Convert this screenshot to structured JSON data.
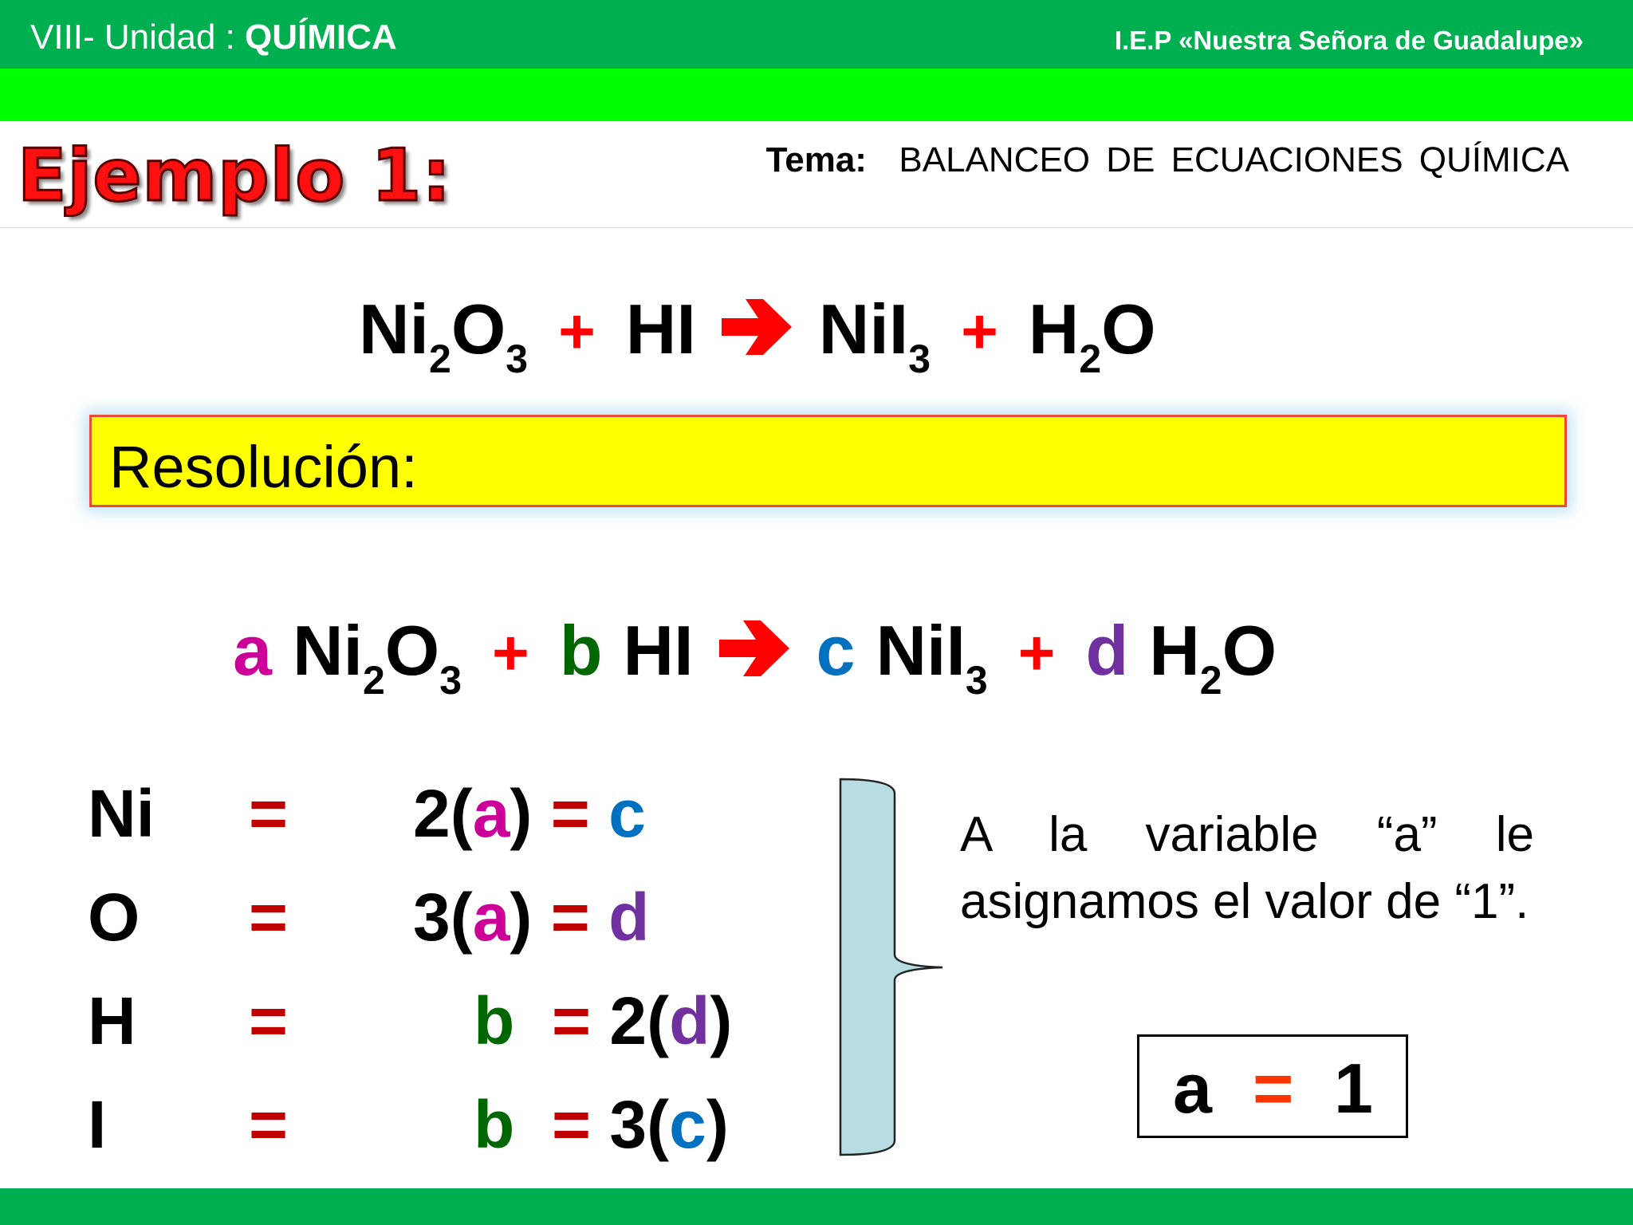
{
  "header": {
    "unit_prefix": "VIII- Unidad : ",
    "unit_name": "QUÍMICA",
    "school": "I.E.P «Nuestra Señora de Guadalupe»",
    "tema_label": "Tema:",
    "tema_text": "BALANCEO  DE  ECUACIONES  QUÍMICA"
  },
  "example_title": "Ejemplo 1:",
  "equation": {
    "r1_base": "Ni",
    "r1_s1": "2",
    "r1_mid": "O",
    "r1_s2": "3",
    "plus": "+",
    "r2": "HI",
    "p1_base": "NiI",
    "p1_s": "3",
    "p2_base": "H",
    "p2_s": "2",
    "p2_end": "O"
  },
  "resolution_label": "Resolución:",
  "coefficients": {
    "a": "a",
    "b": "b",
    "c": "c",
    "d": "d"
  },
  "system": [
    {
      "element": "Ni",
      "eq": "=",
      "rhs1": "2(",
      "var1": "a",
      "rhs2": ") ",
      "eq2": "=",
      "rhs3": " ",
      "var2": "c",
      "rhs4": ""
    },
    {
      "element": "O",
      "eq": "=",
      "rhs1": "3(",
      "var1": "a",
      "rhs2": ") ",
      "eq2": "=",
      "rhs3": " ",
      "var2": "d",
      "rhs4": ""
    },
    {
      "element": "H",
      "eq": "=",
      "lhs_var": "b",
      "eq2": "=",
      "rhs1": " 2(",
      "var2": "d",
      "rhs2": ")"
    },
    {
      "element": "I",
      "eq": "=",
      "lhs_var": "b",
      "eq2": "=",
      "rhs1": " 3(",
      "var2": "c",
      "rhs2": ")"
    }
  ],
  "note": "A la variable “a” le asignamos el valor de “1”.",
  "answer": {
    "var": "a",
    "eq": "=",
    "value": "1"
  },
  "colors": {
    "top_bar": "#00b050",
    "sub_bar": "#00ff00",
    "title_red": "#ff1010",
    "var_a": "#cc0099",
    "var_b": "#006600",
    "var_c": "#0070c0",
    "var_d": "#7030a0",
    "equals_red": "#c00000",
    "highlight_yellow": "#ffff00"
  }
}
